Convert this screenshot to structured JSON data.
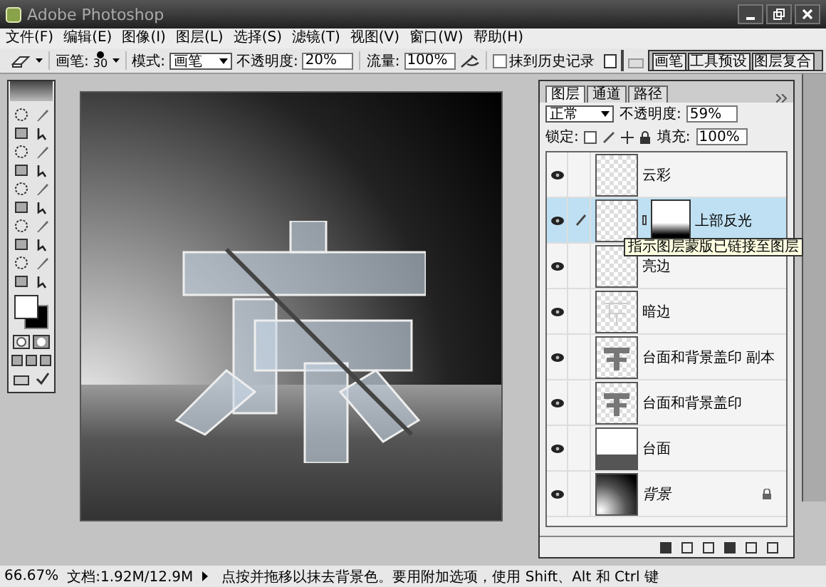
{
  "window": {
    "title": "Adobe Photoshop"
  },
  "menu": [
    "文件(F)",
    "编辑(E)",
    "图像(I)",
    "图层(L)",
    "选择(S)",
    "滤镜(T)",
    "视图(V)",
    "窗口(W)",
    "帮助(H)"
  ],
  "options_bar": {
    "brush_label": "画笔:",
    "brush_size": "30",
    "mode_label": "模式:",
    "mode": "画笔",
    "opacity_label": "不透明度:",
    "opacity": "20%",
    "flow_label": "流量:",
    "flow": "100%",
    "erase_to_history": {
      "label": "抹到历史记录",
      "checked": false
    }
  },
  "palette_well_tabs": [
    "画笔",
    "工具预设",
    "图层复合"
  ],
  "layers_panel": {
    "tabs": [
      {
        "label": "图层",
        "selected": true
      },
      {
        "label": "通道",
        "selected": false
      },
      {
        "label": "路径",
        "selected": false
      }
    ],
    "blend_mode": "正常",
    "opacity_label": "不透明度:",
    "opacity": "59%",
    "lock_label": "锁定:",
    "fill_label": "填充:",
    "fill": "100%",
    "layers": [
      {
        "name": "云彩",
        "visible": true,
        "selected": false,
        "kind": "empty",
        "has_mask": false,
        "locked": false,
        "background": false
      },
      {
        "name": "上部反光",
        "visible": true,
        "selected": true,
        "kind": "empty",
        "has_mask": true,
        "locked": false,
        "background": false,
        "tooltip": "指示图层蒙版已链接至图层"
      },
      {
        "name": "亮边",
        "visible": true,
        "selected": false,
        "kind": "empty",
        "has_mask": false,
        "locked": false,
        "background": false
      },
      {
        "name": "暗边",
        "visible": true,
        "selected": false,
        "kind": "outline",
        "has_mask": false,
        "locked": false,
        "background": false
      },
      {
        "name": "台面和背景盖印 副本",
        "visible": true,
        "selected": false,
        "kind": "character",
        "has_mask": false,
        "locked": false,
        "background": false
      },
      {
        "name": "台面和背景盖印",
        "visible": true,
        "selected": false,
        "kind": "character",
        "has_mask": false,
        "locked": false,
        "background": false
      },
      {
        "name": "台面",
        "visible": true,
        "selected": false,
        "kind": "surface",
        "has_mask": false,
        "locked": false,
        "background": false
      },
      {
        "name": "背景",
        "visible": true,
        "selected": false,
        "kind": "gradient",
        "has_mask": false,
        "locked": true,
        "background": true
      }
    ]
  },
  "status_bar": {
    "zoom": "66.67%",
    "doc_size": "文档:1.92M/12.9M",
    "hint": "点按并拖移以抹去背景色。要用附加选项，使用 Shift、Alt 和 Ctrl 键"
  }
}
